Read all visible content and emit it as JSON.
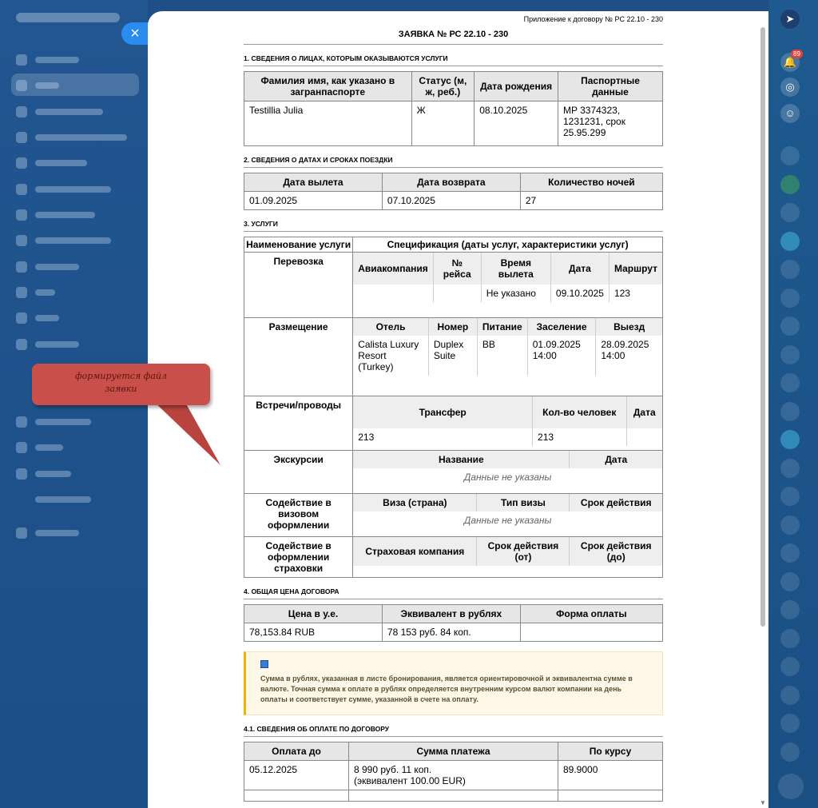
{
  "window": {
    "close_label": "×"
  },
  "doc": {
    "appendix": "Приложение к договору № PC 22.10 - 230",
    "title": "ЗАЯВКА № РС 22.10 - 230"
  },
  "sec1": {
    "title": "1. СВЕДЕНИЯ О ЛИЦАХ, КОТОРЫМ ОКАЗЫВАЮТСЯ УСЛУГИ",
    "headers": [
      "Фамилия имя, как указано в загранпаспорте",
      "Статус (м, ж, реб.)",
      "Дата рождения",
      "Паспортные данные"
    ],
    "row": [
      "Testillia Julia",
      "Ж",
      "08.10.2025",
      "MP 3374323, 1231231, срок 25.95.299"
    ]
  },
  "sec2": {
    "title": "2. СВЕДЕНИЯ О ДАТАХ И СРОКАХ ПОЕЗДКИ",
    "headers": [
      "Дата вылета",
      "Дата возврата",
      "Количество ночей"
    ],
    "row": [
      "01.09.2025",
      "07.10.2025",
      "27"
    ]
  },
  "sec3": {
    "title": "3. УСЛУГИ",
    "col_name": "Наименование услуги",
    "col_spec": "Спецификация (даты услуг, характеристики услуг)",
    "transport": {
      "name": "Перевозка",
      "headers": [
        "Авиакомпания",
        "№ рейса",
        "Время вылета",
        "Дата",
        "Маршрут"
      ],
      "row": [
        "",
        "",
        "Не указано",
        "09.10.2025",
        "123"
      ]
    },
    "hotel": {
      "name": "Размещение",
      "headers": [
        "Отель",
        "Номер",
        "Питание",
        "Заселение",
        "Выезд"
      ],
      "row": [
        "Calista Luxury Resort (Turkey)",
        "Duplex Suite",
        "BB",
        "01.09.2025 14:00",
        "28.09.2025 14:00"
      ]
    },
    "transfer": {
      "name": "Встречи/проводы",
      "headers": [
        "Трансфер",
        "Кол-во человек",
        "Дата"
      ],
      "row": [
        "213",
        "213",
        ""
      ]
    },
    "excursion": {
      "name": "Экскурсии",
      "headers": [
        "Название",
        "Дата"
      ],
      "empty": "Данные не указаны"
    },
    "visa": {
      "name": "Содействие в визовом оформлении",
      "headers": [
        "Виза (страна)",
        "Тип визы",
        "Срок действия"
      ],
      "empty": "Данные не указаны"
    },
    "insurance": {
      "name": "Содействие в оформлении страховки",
      "headers": [
        "Страховая компания",
        "Срок действия (от)",
        "Срок действия (до)"
      ]
    }
  },
  "sec4": {
    "title": "4. ОБЩАЯ ЦЕНА ДОГОВОРА",
    "headers": [
      "Цена в у.е.",
      "Эквивалент в рублях",
      "Форма оплаты"
    ],
    "row": [
      "78,153.84 RUB",
      "78 153 руб. 84 коп.",
      ""
    ]
  },
  "note": "Сумма в рублях, указанная в листе бронирования, является ориентировочной и эквивалентна сумме в валюте. Точная сумма к оплате в рублях определяется внутренним курсом валют компании на день оплаты и соответствует сумме, указанной в счете на оплату.",
  "sec41": {
    "title": "4.1. СВЕДЕНИЯ ОБ ОПЛАТЕ ПО ДОГОВОРУ",
    "headers": [
      "Оплата до",
      "Сумма платежа",
      "По курсу"
    ],
    "row": [
      "05.12.2025",
      "8 990 руб. 11 коп.",
      "(эквивалент 100.00 EUR)",
      "89.9000"
    ]
  },
  "callout": {
    "line1": "формируется файл",
    "line2": "заявки"
  },
  "rail": {
    "badge": "89"
  }
}
